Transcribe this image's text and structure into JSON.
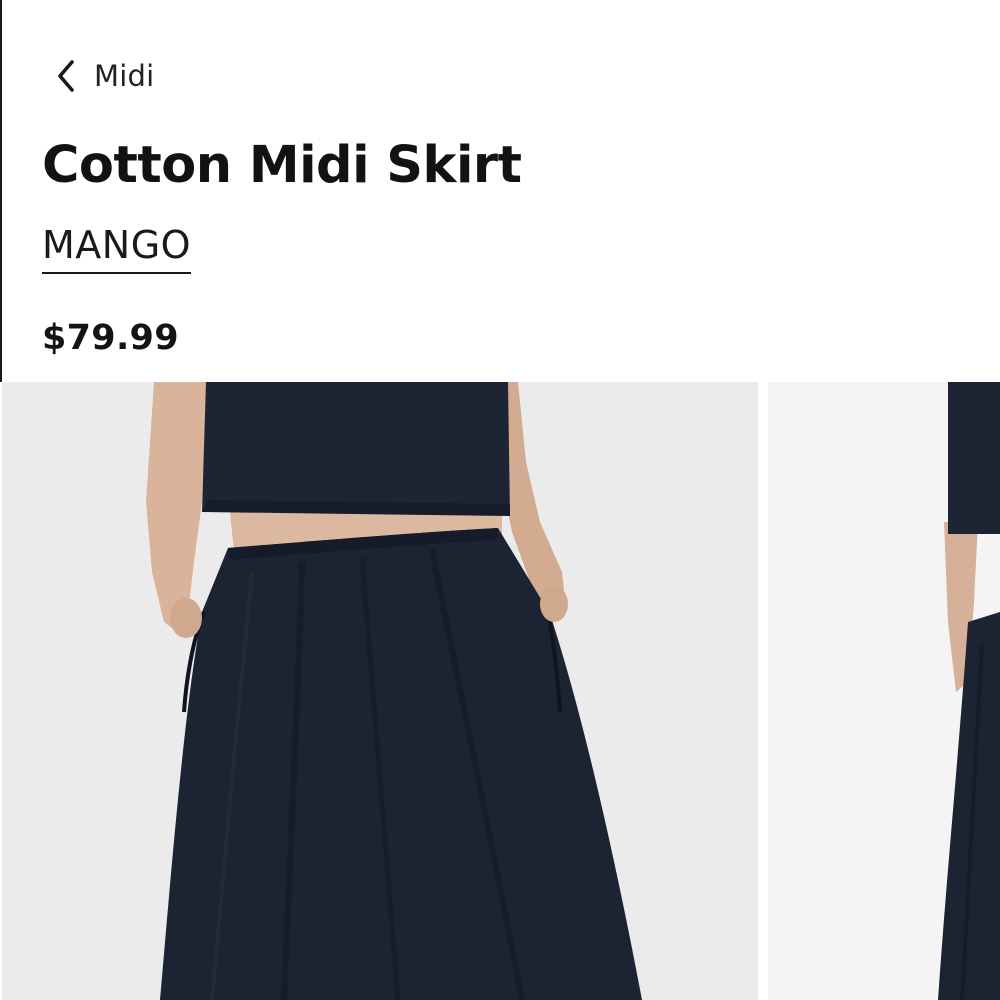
{
  "nav": {
    "back_label": "Midi",
    "back_icon": "chevron-left-icon"
  },
  "product": {
    "title": "Cotton Midi Skirt",
    "brand": "MANGO",
    "price": "$79.99"
  },
  "gallery": {
    "images": [
      {
        "name": "product-image-front",
        "alt": "Model wearing navy cotton midi skirt with matching cropped top, hands in pockets"
      },
      {
        "name": "product-image-side",
        "alt": "Side view of model wearing navy cotton midi skirt"
      }
    ]
  },
  "colors": {
    "text": "#121212",
    "garment": "#1c2333",
    "backdrop": "#ebebeb",
    "skin": "#d9b49a"
  }
}
